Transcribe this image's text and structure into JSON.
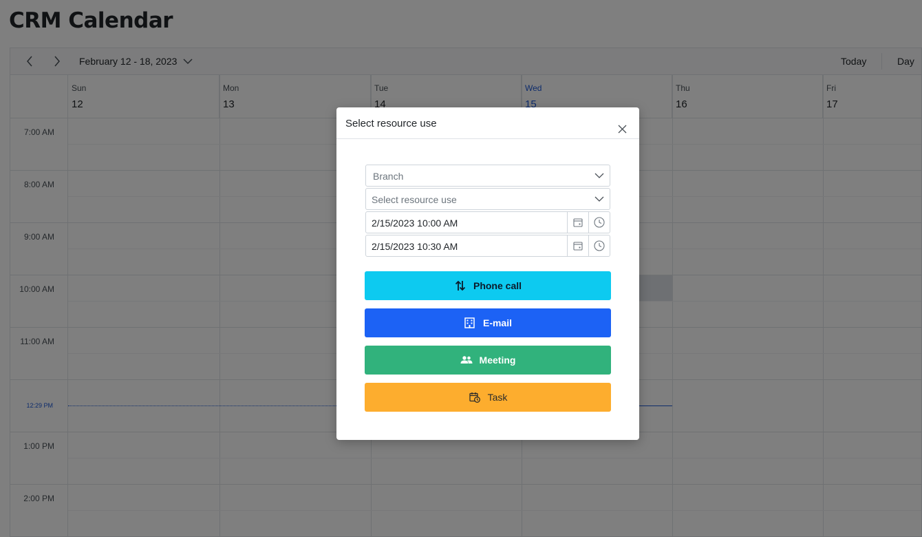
{
  "page": {
    "title": "CRM Calendar"
  },
  "toolbar": {
    "prev_icon": "chevron-left-icon",
    "next_icon": "chevron-right-icon",
    "date_range": "February 12 - 18, 2023",
    "today_label": "Today",
    "view_label": "Day"
  },
  "calendar": {
    "days": [
      {
        "name": "Sun",
        "number": "12"
      },
      {
        "name": "Mon",
        "number": "13"
      },
      {
        "name": "Tue",
        "number": "14"
      },
      {
        "name": "Wed",
        "number": "15"
      },
      {
        "name": "Thu",
        "number": "16"
      },
      {
        "name": "Fri",
        "number": "17"
      }
    ],
    "current_day": "Wed",
    "time_slots": [
      "7:00 AM",
      "8:00 AM",
      "9:00 AM",
      "10:00 AM",
      "11:00 AM",
      "1:00 PM",
      "2:00 PM"
    ],
    "current_time": "12:29 PM",
    "colors": {
      "current": "#1b57d6",
      "selected_slot": "#dde1e6"
    }
  },
  "dialog": {
    "title": "Select resource use",
    "branch_placeholder": "Branch",
    "resource_placeholder": "Select resource use",
    "start_datetime": "2/15/2023 10:00 AM",
    "end_datetime": "2/15/2023 10:30 AM",
    "buttons": [
      {
        "label": "Phone call",
        "icon": "arrows-up-down-icon",
        "color": "#0dcaf0"
      },
      {
        "label": "E-mail",
        "icon": "building-icon",
        "color": "#1c62f5"
      },
      {
        "label": "Meeting",
        "icon": "people-icon",
        "color": "#31b27c"
      },
      {
        "label": "Task",
        "icon": "calendar-clock-icon",
        "color": "#fdad2e"
      }
    ]
  }
}
